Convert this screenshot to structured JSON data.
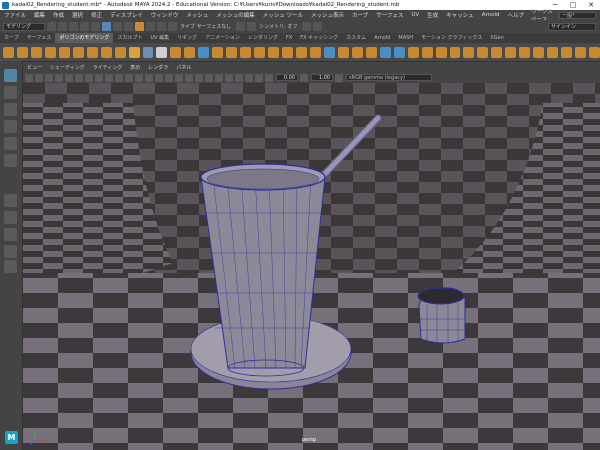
{
  "window": {
    "title": "kadai02_Rendering_student.mb* - Autodesk MAYA 2024.2 - Educational Version: C:¥Users¥kuris¥Downloads¥kadai02_Rendering_student.mb",
    "minimize": "─",
    "maximize": "□",
    "close": "✕"
  },
  "menu": {
    "items": [
      "ファイル",
      "編集",
      "作成",
      "選択",
      "修正",
      "ディスプレイ",
      "ウィンドウ",
      "メッシュ",
      "メッシュの編集",
      "メッシュ ツール",
      "メッシュ表示",
      "カーブ",
      "サーフェス",
      "UV",
      "生成",
      "キャッシュ",
      "Arnold",
      "ヘルプ"
    ],
    "workspace_label": "ワークスペース:",
    "workspace_value": "一般*"
  },
  "status": {
    "mode": "モデリング",
    "symmetry": "シンメトリ: オフ",
    "live": "ライブ サーフェスなし",
    "sign_in": "サインイン"
  },
  "shelf_tabs": [
    "カーブ",
    "サーフェス",
    "ポリゴンのモデリング",
    "スカルプト",
    "UV 編集",
    "リギング",
    "アニメーション",
    "レンダリング",
    "FX",
    "FX キャッシング",
    "カスタム",
    "Arnold",
    "MASH",
    "モーション グラフィックス",
    "XGen"
  ],
  "shelf_active_index": 2,
  "view_menu": [
    "ビュー",
    "シェーディング",
    "ライティング",
    "表示",
    "レンダラ",
    "パネル"
  ],
  "view_toolbar": {
    "exposure": "0.00",
    "gamma": "1.00",
    "color_space": "sRGB gamma (legacy)"
  },
  "viewport": {
    "camera": "persp"
  }
}
